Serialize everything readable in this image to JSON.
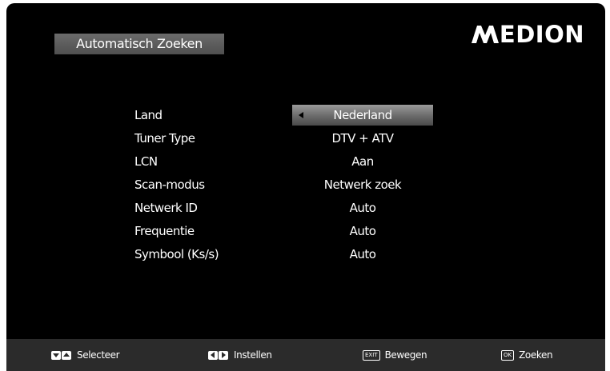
{
  "menu": {
    "title": "Automatisch Zoeken"
  },
  "brand": {
    "name": "EDION"
  },
  "settings": [
    {
      "label": "Land",
      "value": "Nederland",
      "selected": true
    },
    {
      "label": "Tuner Type",
      "value": "DTV + ATV"
    },
    {
      "label": "LCN",
      "value": "Aan"
    },
    {
      "label": "Scan-modus",
      "value": "Netwerk zoek"
    },
    {
      "label": "Netwerk ID",
      "value": "Auto"
    },
    {
      "label": "Frequentie",
      "value": "Auto"
    },
    {
      "label": "Symbool (Ks/s)",
      "value": "Auto"
    }
  ],
  "footer": {
    "select": {
      "icons": [
        "down-arrow-key-icon",
        "up-arrow-key-icon"
      ],
      "label": "Selecteer"
    },
    "set": {
      "icons": [
        "left-arrow-key-icon",
        "right-arrow-key-icon"
      ],
      "label": "Instellen"
    },
    "move": {
      "key": "EXIT",
      "label": "Bewegen"
    },
    "search": {
      "key": "OK",
      "label": "Zoeken"
    }
  },
  "colors": {
    "background": "#000000",
    "footer": "#2b2b2b",
    "highlight": "#7a7a7a",
    "text": "#ffffff"
  }
}
